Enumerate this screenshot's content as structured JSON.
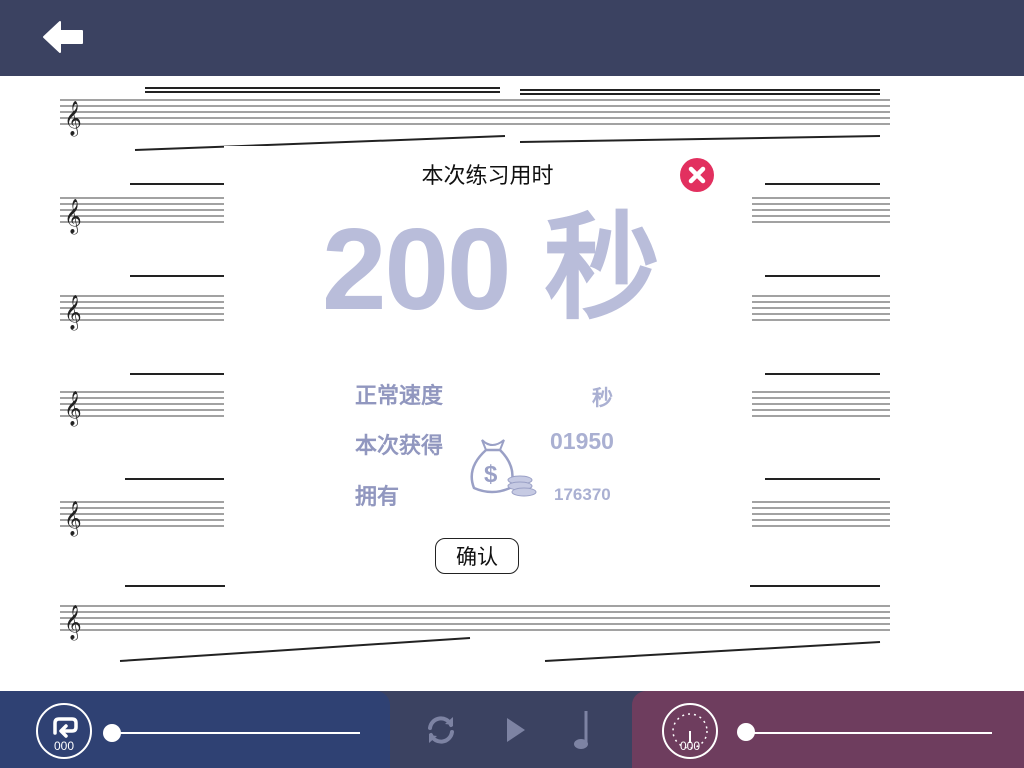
{
  "header": {
    "back_icon": "back-arrow-icon"
  },
  "dialog": {
    "title": "本次练习用时",
    "time_value": "200",
    "time_unit": "秒",
    "rows": [
      {
        "label": "正常速度",
        "value": "秒"
      },
      {
        "label": "本次获得",
        "value": "01950"
      },
      {
        "label": "拥有",
        "value": "176370"
      }
    ],
    "confirm_label": "确认",
    "close_icon": "close-icon",
    "coin_icon": "money-bag-icon"
  },
  "bottom": {
    "loop_count": "000",
    "tempo_count": "000",
    "icons": [
      "loop-icon",
      "refresh-icon",
      "play-icon",
      "note-icon",
      "metronome-dial-icon"
    ]
  },
  "colors": {
    "bar": "#3b4261",
    "left_panel": "#2f4173",
    "right_panel": "#6e3d5e",
    "accent_red": "#e2305f",
    "soft_text": "#b9bdda"
  }
}
